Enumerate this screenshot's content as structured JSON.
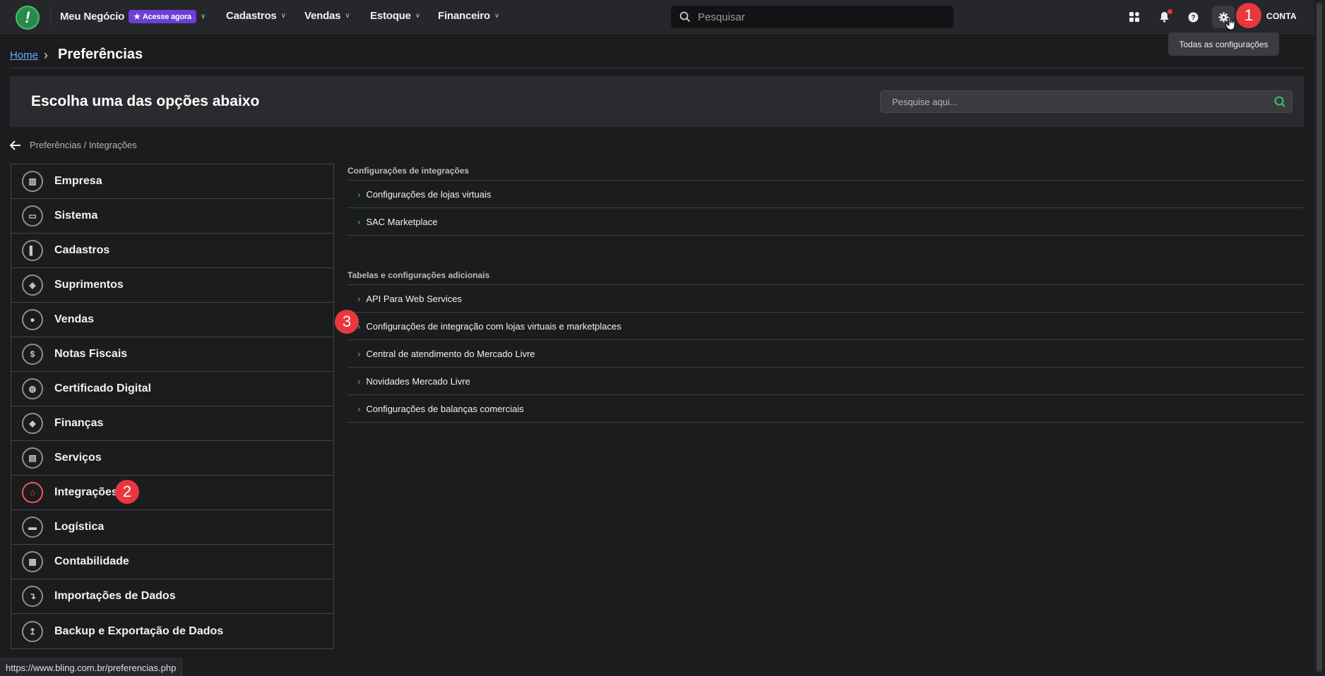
{
  "topbar": {
    "business": "Meu Negócio",
    "acesse_badge": "Acesse agora",
    "nav": [
      "Cadastros",
      "Vendas",
      "Estoque",
      "Financeiro"
    ],
    "search_placeholder": "Pesquisar",
    "account_label": "CONTA",
    "tooltip": "Todas as configurações",
    "icons": [
      "apps-icon",
      "bell-icon",
      "help-icon",
      "gear-icon"
    ]
  },
  "annotations": [
    "1",
    "2",
    "3"
  ],
  "breadcrumb": {
    "home": "Home",
    "title": "Preferências"
  },
  "banner": {
    "title": "Escolha uma das opções abaixo",
    "search_placeholder": "Pesquise aqui..."
  },
  "subpath": "Preferências / Integrações",
  "menu": [
    {
      "label": "Empresa",
      "icon": "building-icon"
    },
    {
      "label": "Sistema",
      "icon": "monitor-icon"
    },
    {
      "label": "Cadastros",
      "icon": "book-icon"
    },
    {
      "label": "Suprimentos",
      "icon": "box-icon"
    },
    {
      "label": "Vendas",
      "icon": "users-icon"
    },
    {
      "label": "Notas Fiscais",
      "icon": "receipt-icon"
    },
    {
      "label": "Certificado Digital",
      "icon": "lock-icon"
    },
    {
      "label": "Finanças",
      "icon": "piggy-bank-icon"
    },
    {
      "label": "Serviços",
      "icon": "clipboard-icon"
    },
    {
      "label": "Integrações",
      "icon": "plug-icon"
    },
    {
      "label": "Logística",
      "icon": "truck-icon"
    },
    {
      "label": "Contabilidade",
      "icon": "calculator-icon"
    },
    {
      "label": "Importações de Dados",
      "icon": "import-icon"
    },
    {
      "label": "Backup e Exportação de Dados",
      "icon": "export-icon"
    }
  ],
  "sections": [
    {
      "title": "Configurações de integrações",
      "links": [
        "Configurações de lojas virtuais",
        "SAC Marketplace"
      ]
    },
    {
      "title": "Tabelas e configurações adicionais",
      "links": [
        "API Para Web Services",
        "Configurações de integração com lojas virtuais e marketplaces",
        "Central de atendimento do Mercado Livre",
        "Novidades Mercado Livre",
        "Configurações de balanças comerciais"
      ]
    }
  ],
  "status_url": "https://www.bling.com.br/preferencias.php",
  "colors": {
    "accent_red": "#e8383e",
    "accent_green": "#3fbf6a",
    "badge_purple": "#6d3fd6",
    "link_blue": "#6aa8ff"
  }
}
